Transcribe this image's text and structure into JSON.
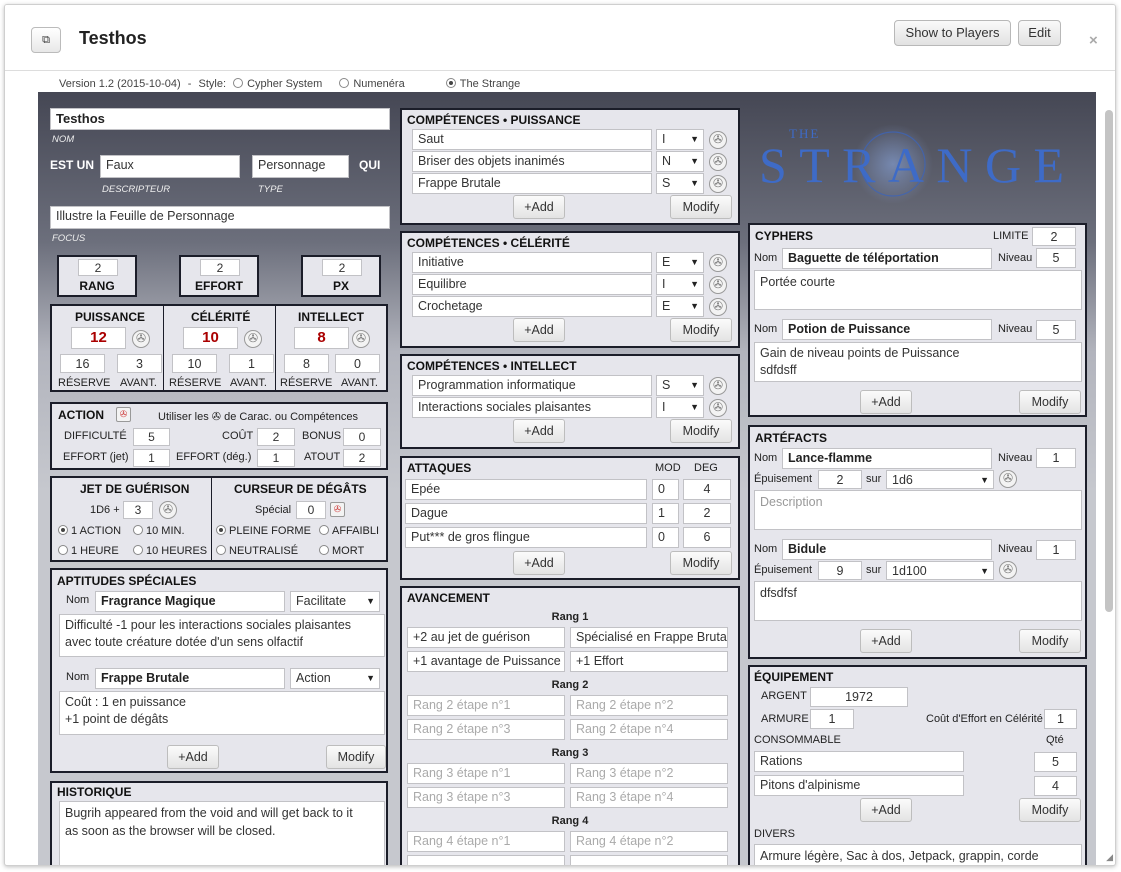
{
  "window": {
    "title": "Testhos",
    "show_to_players": "Show to Players",
    "edit": "Edit",
    "close": "×"
  },
  "version": {
    "text": "Version 1.2 (2015-10-04)",
    "sep": "-",
    "style_label": "Style:",
    "styles": [
      "Cypher System",
      "Numenéra",
      "The Strange"
    ]
  },
  "identity": {
    "name": "Testhos",
    "name_label": "NOM",
    "est_un": "EST UN",
    "descriptor": "Faux",
    "descriptor_label": "DESCRIPTEUR",
    "type": "Personnage",
    "type_label": "TYPE",
    "qui": "QUI",
    "focus": "Illustre la Feuille de Personnage",
    "focus_label": "FOCUS"
  },
  "tiers": [
    {
      "value": "2",
      "label": "RANG"
    },
    {
      "value": "2",
      "label": "EFFORT"
    },
    {
      "value": "2",
      "label": "PX"
    }
  ],
  "stats": {
    "sub": [
      "RÉSERVE",
      "AVANT."
    ],
    "pools": [
      {
        "name": "PUISSANCE",
        "value": "12",
        "reserve": "16",
        "edge": "3"
      },
      {
        "name": "CÉLÉRITÉ",
        "value": "10",
        "reserve": "10",
        "edge": "1"
      },
      {
        "name": "INTELLECT",
        "value": "8",
        "reserve": "8",
        "edge": "0"
      }
    ]
  },
  "action": {
    "title": "ACTION",
    "use_text": "Utiliser les",
    "use_text2": "de Carac. ou Compétences",
    "difficulty_label": "DIFFICULTÉ",
    "difficulty": "5",
    "cost_label": "COÛT",
    "cost": "2",
    "bonus_label": "BONUS",
    "bonus": "0",
    "effort_jet_label": "EFFORT (jet)",
    "effort_jet": "1",
    "effort_deg_label": "EFFORT (dég.)",
    "effort_deg": "1",
    "atout_label": "ATOUT",
    "atout": "2"
  },
  "recovery": {
    "title": "JET DE GUÉRISON",
    "roll": "1D6 +",
    "bonus": "3",
    "options": [
      "1 ACTION",
      "10 MIN.",
      "1 HEURE",
      "10 HEURES"
    ]
  },
  "damage": {
    "title": "CURSEUR DE DÉGÂTS",
    "special_label": "Spécial",
    "special": "0",
    "options": [
      "PLEINE FORME",
      "AFFAIBLI",
      "NEUTRALISÉ",
      "MORT"
    ]
  },
  "abilities": {
    "title": "APTITUDES SPÉCIALES",
    "nom": "Nom",
    "items": [
      {
        "name": "Fragrance Magique",
        "type": "Facilitate",
        "desc": "Difficulté -1 pour les interactions sociales plaisantes\navec toute créature dotée d'un sens olfactif"
      },
      {
        "name": "Frappe Brutale",
        "type": "Action",
        "desc": "Coût : 1 en puissance\n+1 point de dégâts"
      }
    ],
    "add": "+Add",
    "modify": "Modify"
  },
  "history": {
    "title": "HISTORIQUE",
    "text": "Bugrih appeared from the void and will get back to it\nas soon as the browser will be closed."
  },
  "skills": {
    "add": "+Add",
    "modify": "Modify",
    "groups": [
      {
        "title": "COMPÉTENCES • PUISSANCE",
        "items": [
          {
            "name": "Saut",
            "level": "I"
          },
          {
            "name": "Briser des objets inanimés",
            "level": "N"
          },
          {
            "name": "Frappe Brutale",
            "level": "S"
          }
        ]
      },
      {
        "title": "COMPÉTENCES • CÉLÉRITÉ",
        "items": [
          {
            "name": "Initiative",
            "level": "E"
          },
          {
            "name": "Equilibre",
            "level": "I"
          },
          {
            "name": "Crochetage",
            "level": "E"
          }
        ]
      },
      {
        "title": "COMPÉTENCES • INTELLECT",
        "items": [
          {
            "name": "Programmation informatique",
            "level": "S"
          },
          {
            "name": "Interactions sociales plaisantes",
            "level": "I"
          }
        ]
      }
    ]
  },
  "attacks": {
    "title": "ATTAQUES",
    "mod": "MOD",
    "deg": "DEG",
    "items": [
      {
        "name": "Epée",
        "mod": "0",
        "deg": "4"
      },
      {
        "name": "Dague",
        "mod": "1",
        "deg": "2"
      },
      {
        "name": "Put*** de gros flingue",
        "mod": "0",
        "deg": "6"
      }
    ],
    "add": "+Add",
    "modify": "Modify"
  },
  "advancement": {
    "title": "AVANCEMENT",
    "ranks": [
      {
        "label": "Rang 1",
        "steps": [
          "+2 au jet de guérison",
          "Spécialisé en Frappe Bruta",
          "+1 avantage de Puissance",
          "+1 Effort"
        ]
      },
      {
        "label": "Rang 2",
        "steps": [
          "Rang 2 étape n°1",
          "Rang 2 étape n°2",
          "Rang 2 étape n°3",
          "Rang 2 étape n°4"
        ]
      },
      {
        "label": "Rang 3",
        "steps": [
          "Rang 3 étape n°1",
          "Rang 3 étape n°2",
          "Rang 3 étape n°3",
          "Rang 3 étape n°4"
        ]
      },
      {
        "label": "Rang 4",
        "steps": [
          "Rang 4 étape n°1",
          "Rang 4 étape n°2"
        ]
      }
    ]
  },
  "logo": {
    "text": "THE STRANGE",
    "small": "THE",
    "main": "STRANGE"
  },
  "cyphers": {
    "title": "CYPHERS",
    "limit_label": "LIMITE",
    "limit": "2",
    "nom": "Nom",
    "niveau": "Niveau",
    "items": [
      {
        "name": "Baguette de téléportation",
        "level": "5",
        "desc": "Portée courte"
      },
      {
        "name": "Potion de Puissance",
        "level": "5",
        "desc": "Gain de niveau points de Puissance\nsdfdsff"
      }
    ],
    "add": "+Add",
    "modify": "Modify"
  },
  "artifacts": {
    "title": "ARTÉFACTS",
    "nom": "Nom",
    "niveau": "Niveau",
    "epuisement": "Épuisement",
    "sur": "sur",
    "items": [
      {
        "name": "Lance-flamme",
        "level": "1",
        "depletion": "2",
        "die": "1d6",
        "desc": "Description"
      },
      {
        "name": "Bidule",
        "level": "1",
        "depletion": "9",
        "die": "1d100",
        "desc": "dfsdfsf"
      }
    ],
    "add": "+Add",
    "modify": "Modify"
  },
  "equipment": {
    "title": "ÉQUIPEMENT",
    "money_label": "ARGENT",
    "money": "1972",
    "armor_label": "ARMURE",
    "armor": "1",
    "armor_cost_label": "Coût d'Effort en Célérité",
    "armor_cost": "1",
    "consumable_label": "CONSOMMABLE",
    "qty_label": "Qté",
    "items": [
      {
        "name": "Rations",
        "qty": "5"
      },
      {
        "name": "Pitons d'alpinisme",
        "qty": "4"
      }
    ],
    "add": "+Add",
    "modify": "Modify",
    "misc_label": "DIVERS",
    "misc": "Armure légère, Sac à dos, Jetpack, grappin, corde"
  }
}
